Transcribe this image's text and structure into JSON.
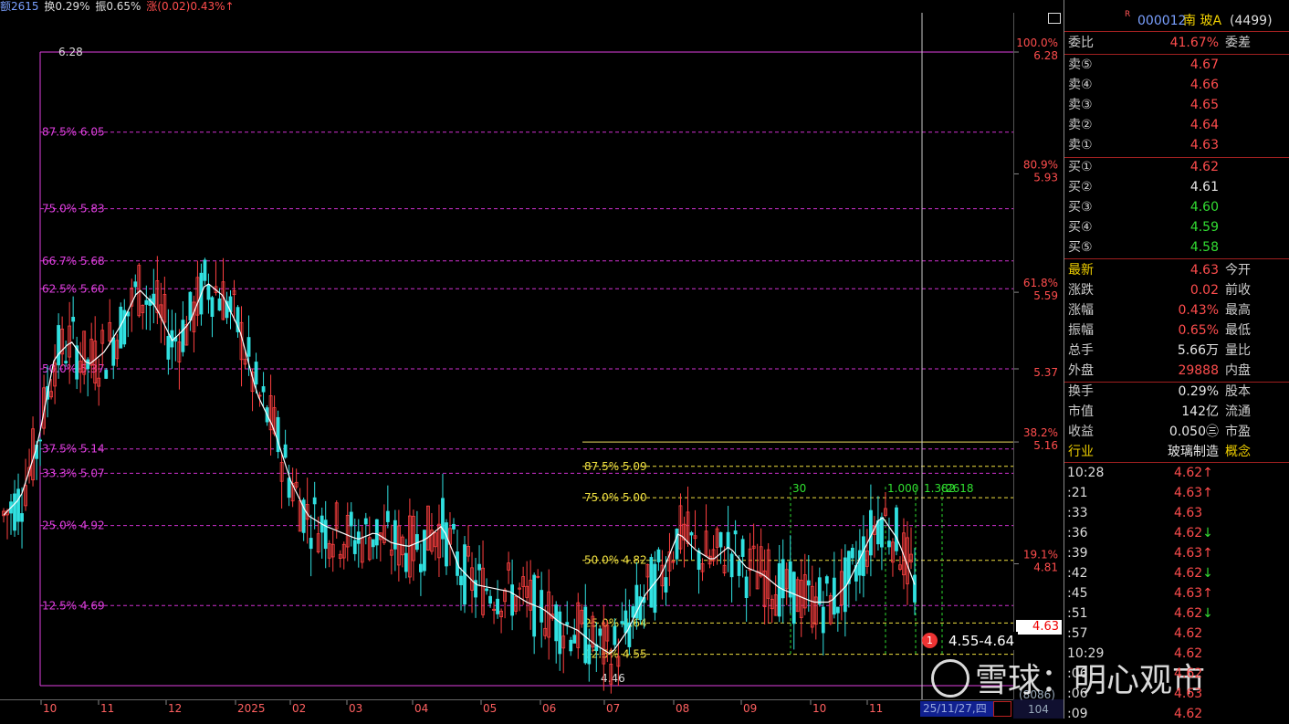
{
  "topbar": {
    "amount": "额2615",
    "turnover": "换0.29%",
    "amplitude": "振0.65%",
    "change": "涨(0.02)0.43%↑"
  },
  "colors": {
    "fib_magenta": "#e040e0",
    "fib_yellow": "#f0e040",
    "up": "#ff4040",
    "down": "#30e0e0",
    "ma": "#ffffff",
    "green_marks": "#30e030"
  },
  "chart_data": {
    "type": "candlestick",
    "x_ticks": [
      "10",
      "11",
      "12",
      "2025",
      "02",
      "03",
      "04",
      "05",
      "06",
      "07",
      "08",
      "09",
      "10",
      "11"
    ],
    "high_label": "6.28",
    "low_label": "4.46",
    "fib_left": [
      {
        "label": "87.5% 6.05",
        "price": 6.05
      },
      {
        "label": "75.0% 5.83",
        "price": 5.83
      },
      {
        "label": "66.7% 5.68",
        "price": 5.68
      },
      {
        "label": "62.5% 5.60",
        "price": 5.6
      },
      {
        "label": "50.0% 5.37",
        "price": 5.37
      },
      {
        "label": "37.5% 5.14",
        "price": 5.14
      },
      {
        "label": "33.3% 5.07",
        "price": 5.07
      },
      {
        "label": "25.0% 4.92",
        "price": 4.92
      },
      {
        "label": "12.5% 4.69",
        "price": 4.69
      }
    ],
    "fib_right": [
      {
        "label": "87.5% 5.09",
        "price": 5.09
      },
      {
        "label": "75.0% 5.00",
        "price": 5.0
      },
      {
        "label": "50.0% 4.82",
        "price": 4.82
      },
      {
        "label": "25.0% 4.64",
        "price": 4.64
      },
      {
        "label": "12.5% 4.55",
        "price": 4.55
      }
    ],
    "y_axis": [
      {
        "pct": "100.0%",
        "price": "6.28"
      },
      {
        "pct": "80.9%",
        "price": "5.93"
      },
      {
        "pct": "61.8%",
        "price": "5.59"
      },
      {
        "pct": "",
        "price": "5.37"
      },
      {
        "pct": "38.2%",
        "price": "5.16"
      },
      {
        "pct": "19.1%",
        "price": "4.81"
      }
    ],
    "green_labels": [
      "30",
      "1.000",
      "1.382",
      "2618"
    ],
    "ma_points": [
      4.95,
      5.0,
      5.15,
      5.4,
      5.45,
      5.38,
      5.42,
      5.5,
      5.6,
      5.55,
      5.45,
      5.5,
      5.62,
      5.58,
      5.48,
      5.3,
      5.2,
      5.05,
      4.95,
      4.92,
      4.9,
      4.88,
      4.9,
      4.87,
      4.86,
      4.88,
      4.92,
      4.8,
      4.75,
      4.74,
      4.73,
      4.7,
      4.68,
      4.64,
      4.62,
      4.58,
      4.55,
      4.62,
      4.72,
      4.78,
      4.9,
      4.85,
      4.82,
      4.86,
      4.8,
      4.78,
      4.74,
      4.72,
      4.7,
      4.7,
      4.75,
      4.85,
      4.95,
      4.88,
      4.75
    ]
  },
  "current_price_tag": "4.63",
  "range_label": "4.55-4.64",
  "range_badge": "1",
  "date_tag": "25/11/27,四",
  "footer_right": {
    "a": "(8086)",
    "b": "104"
  },
  "panel": {
    "header": {
      "superscript": "R",
      "code": "000012",
      "name": "南 玻A",
      "count": "(4499)"
    },
    "weibi": {
      "label": "委比",
      "value": "41.67%",
      "label2": "委差"
    },
    "asks": [
      {
        "label": "卖⑤",
        "price": "4.67"
      },
      {
        "label": "卖④",
        "price": "4.66"
      },
      {
        "label": "卖③",
        "price": "4.65"
      },
      {
        "label": "卖②",
        "price": "4.64"
      },
      {
        "label": "卖①",
        "price": "4.63"
      }
    ],
    "bids": [
      {
        "label": "买①",
        "price": "4.62"
      },
      {
        "label": "买②",
        "price": "4.61"
      },
      {
        "label": "买③",
        "price": "4.60"
      },
      {
        "label": "买④",
        "price": "4.59"
      },
      {
        "label": "买⑤",
        "price": "4.58"
      }
    ],
    "stats1": [
      {
        "label": "最新",
        "value": "4.63",
        "label2": "今开"
      },
      {
        "label": "涨跌",
        "value": "0.02",
        "label2": "前收"
      },
      {
        "label": "涨幅",
        "value": "0.43%",
        "label2": "最高"
      },
      {
        "label": "振幅",
        "value": "0.65%",
        "label2": "最低"
      },
      {
        "label": "总手",
        "value": "5.66万",
        "label2": "量比"
      },
      {
        "label": "外盘",
        "value": "29888",
        "label2": "内盘"
      }
    ],
    "stats2": [
      {
        "label": "换手",
        "value": "0.29%",
        "label2": "股本"
      },
      {
        "label": "市值",
        "value": "142亿",
        "label2": "流通"
      },
      {
        "label": "收益",
        "value": "0.050㊂",
        "label2": "市盈"
      },
      {
        "label": "行业",
        "value": "玻璃制造",
        "label2": "概念"
      }
    ],
    "ticks": [
      {
        "time": "10:28",
        "price": "4.62↑"
      },
      {
        "time": ":21",
        "price": "4.63↑"
      },
      {
        "time": ":33",
        "price": "4.63"
      },
      {
        "time": ":36",
        "price": "4.62↓"
      },
      {
        "time": ":39",
        "price": "4.63↑"
      },
      {
        "time": ":42",
        "price": "4.62↓"
      },
      {
        "time": ":45",
        "price": "4.63↑"
      },
      {
        "time": ":51",
        "price": "4.62↓"
      },
      {
        "time": ":57",
        "price": "4.62"
      },
      {
        "time": "10:29",
        "price": "4.62"
      },
      {
        "time": ":06",
        "price": "4.62"
      },
      {
        "time": ":06",
        "price": "4.63"
      },
      {
        "time": ":09",
        "price": "4.62"
      }
    ]
  },
  "watermark": {
    "text": "雪球：明心观市"
  }
}
